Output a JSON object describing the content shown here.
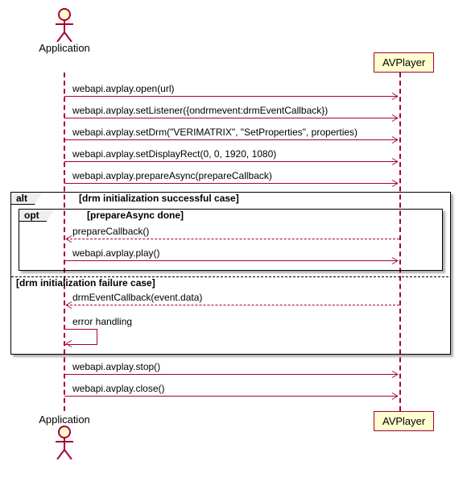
{
  "actors": {
    "application": "Application",
    "avplayer": "AVPlayer"
  },
  "messages": {
    "m1": "webapi.avplay.open(url)",
    "m2": "webapi.avplay.setListener({ondrmevent:drmEventCallback})",
    "m3": "webapi.avplay.setDrm(\"VERIMATRIX\", \"SetProperties\", properties)",
    "m4": "webapi.avplay.setDisplayRect(0, 0, 1920, 1080)",
    "m5": "webapi.avplay.prepareAsync(prepareCallback)",
    "m6": "prepareCallback()",
    "m7": "webapi.avplay.play()",
    "m8": "drmEventCallback(event.data)",
    "m9": "error handling",
    "m10": "webapi.avplay.stop()",
    "m11": "webapi.avplay.close()"
  },
  "fragments": {
    "alt": "alt",
    "alt_cond1": "[drm initialization successful case]",
    "opt": "opt",
    "opt_cond": "[prepareAsync done]",
    "alt_cond2": "[drm initialization failure case]"
  }
}
